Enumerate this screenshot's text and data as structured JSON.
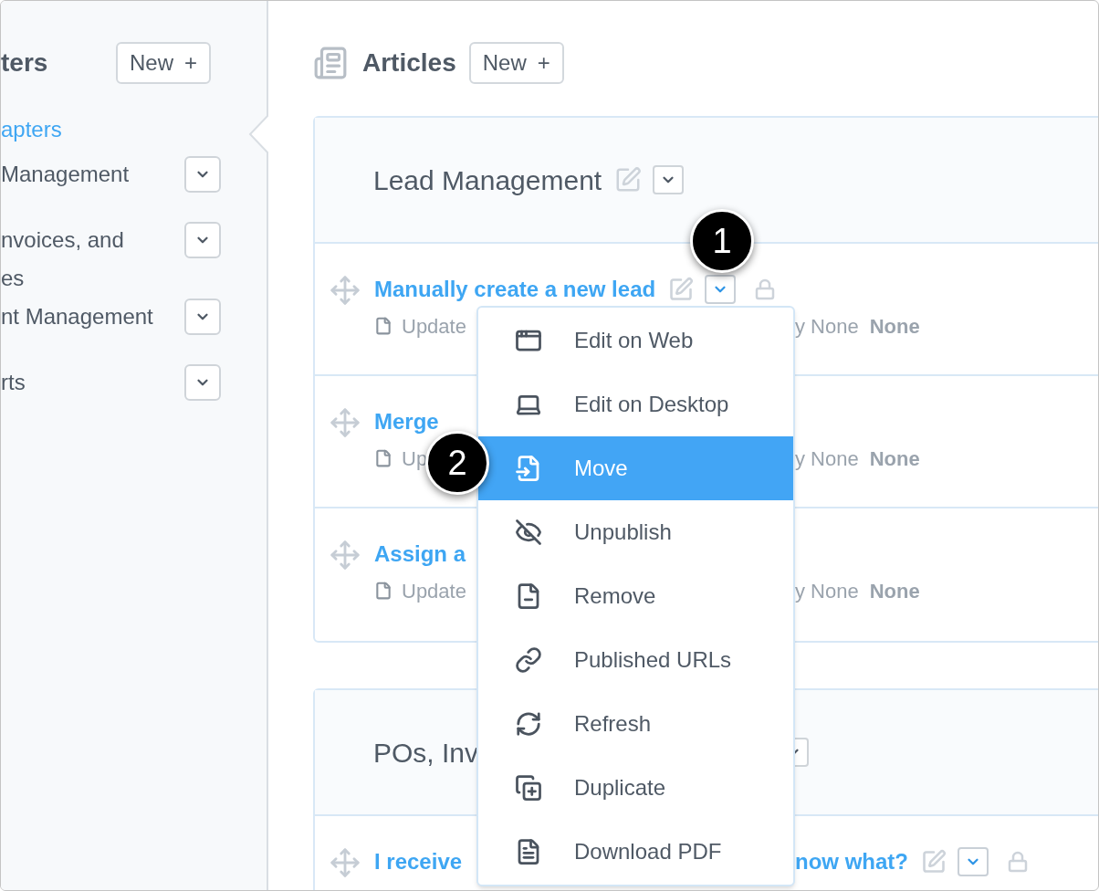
{
  "sidebar": {
    "title": "ters",
    "new_button": {
      "label": "New",
      "icon": "+"
    },
    "all_link": {
      "label": "apters",
      "selected": true
    },
    "chapters": [
      {
        "lines": [
          "Management"
        ]
      },
      {
        "lines": [
          "nvoices, and",
          "es"
        ]
      },
      {
        "lines": [
          "nt Management"
        ]
      },
      {
        "lines": [
          "rts"
        ]
      }
    ]
  },
  "main": {
    "title": "Articles",
    "new_button": {
      "label": "New",
      "icon": "+"
    },
    "sections": [
      {
        "title": "Lead Management",
        "kind": "plain",
        "articles": [
          {
            "title": "Manually create a new lead",
            "kind": "hover",
            "meta_left": "Update",
            "meta_by": "y None",
            "meta_author": "None"
          },
          {
            "title": "Merge",
            "kind": "plain",
            "meta_left": "Up",
            "meta_by": "y None",
            "meta_author": "None"
          },
          {
            "title": "Assign a",
            "kind": "plain",
            "meta_left": "Update",
            "meta_by": "y None",
            "meta_author": "None"
          }
        ]
      },
      {
        "title": "POs, Inv",
        "kind": "overlapped",
        "articles": [
          {
            "title": "I receive",
            "title_right": "now what?",
            "kind": "hover"
          }
        ]
      }
    ]
  },
  "menu": [
    {
      "label": "Edit on Web",
      "kind": "window",
      "selected": false
    },
    {
      "label": "Edit on Desktop",
      "kind": "laptop",
      "selected": false
    },
    {
      "label": "Move",
      "kind": "move",
      "selected": true
    },
    {
      "label": "Unpublish",
      "kind": "unpublish",
      "selected": false
    },
    {
      "label": "Remove",
      "kind": "remove",
      "selected": false
    },
    {
      "label": "Published URLs",
      "kind": "link",
      "selected": false
    },
    {
      "label": "Refresh",
      "kind": "refresh",
      "selected": false
    },
    {
      "label": "Duplicate",
      "kind": "duplicate",
      "selected": false
    },
    {
      "label": "Download PDF",
      "kind": "pdf",
      "selected": false
    }
  ],
  "callouts": [
    {
      "label": "1"
    },
    {
      "label": "2"
    }
  ]
}
